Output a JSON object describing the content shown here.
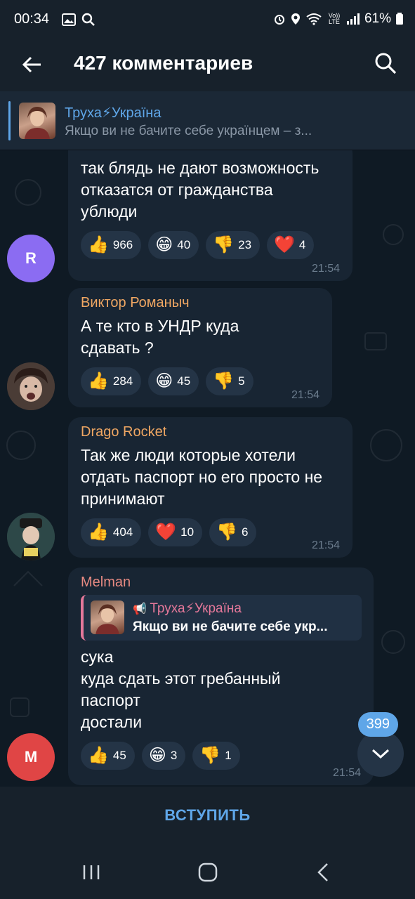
{
  "status": {
    "time": "00:34",
    "battery": "61%",
    "left_icons": [
      "image-icon",
      "search-icon"
    ],
    "right_icons": [
      "alarm-icon",
      "location-icon",
      "wifi-icon",
      "volte-icon",
      "signal-icon",
      "battery-icon"
    ],
    "volte": "Vo)) LTE"
  },
  "header": {
    "title": "427 комментариев"
  },
  "pinned": {
    "title": "Труха⚡Україна",
    "text": "Якщо ви не бачите себе українцем – з..."
  },
  "messages": [
    {
      "avatar_letter": "R",
      "avatar_color": "#8b6cf2",
      "text": "так блядь не дают возможность отказатся от гражданства ублюди",
      "time": "21:54",
      "reactions": [
        {
          "emoji": "👍",
          "count": "966"
        },
        {
          "emoji": "😁",
          "count": "40"
        },
        {
          "emoji": "👎",
          "count": "23"
        },
        {
          "emoji": "❤️",
          "count": "4"
        }
      ]
    },
    {
      "author": "Виктор Романыч",
      "author_color": "#f0a763",
      "text": "А те кто в УНДР куда сдавать ?",
      "time": "21:54",
      "reactions": [
        {
          "emoji": "👍",
          "count": "284"
        },
        {
          "emoji": "😁",
          "count": "45"
        },
        {
          "emoji": "👎",
          "count": "5"
        }
      ]
    },
    {
      "author": "Drago Rocket",
      "author_color": "#f0a763",
      "text": "Так же люди которые хотели отдать паспорт но его просто не принимают",
      "time": "21:54",
      "reactions": [
        {
          "emoji": "👍",
          "count": "404"
        },
        {
          "emoji": "❤️",
          "count": "10"
        },
        {
          "emoji": "👎",
          "count": "6"
        }
      ]
    },
    {
      "author": "Melman",
      "author_color": "#e88a82",
      "avatar_letter": "M",
      "avatar_color": "#e04545",
      "reply_title": "Труха⚡Україна",
      "reply_text": "Якщо ви не бачите себе укр...",
      "text_lines": [
        "сука",
        "куда сдать этот гребанный",
        "паспорт",
        "достали"
      ],
      "time": "21:54",
      "reactions": [
        {
          "emoji": "👍",
          "count": "45"
        },
        {
          "emoji": "😁",
          "count": "3"
        },
        {
          "emoji": "👎",
          "count": "1"
        }
      ]
    }
  ],
  "scroll_badge": "399",
  "join_button": "ВСТУПИТЬ",
  "colors": {
    "accent": "#5fa6e8",
    "bubble": "#182533",
    "background": "#0e1621"
  }
}
